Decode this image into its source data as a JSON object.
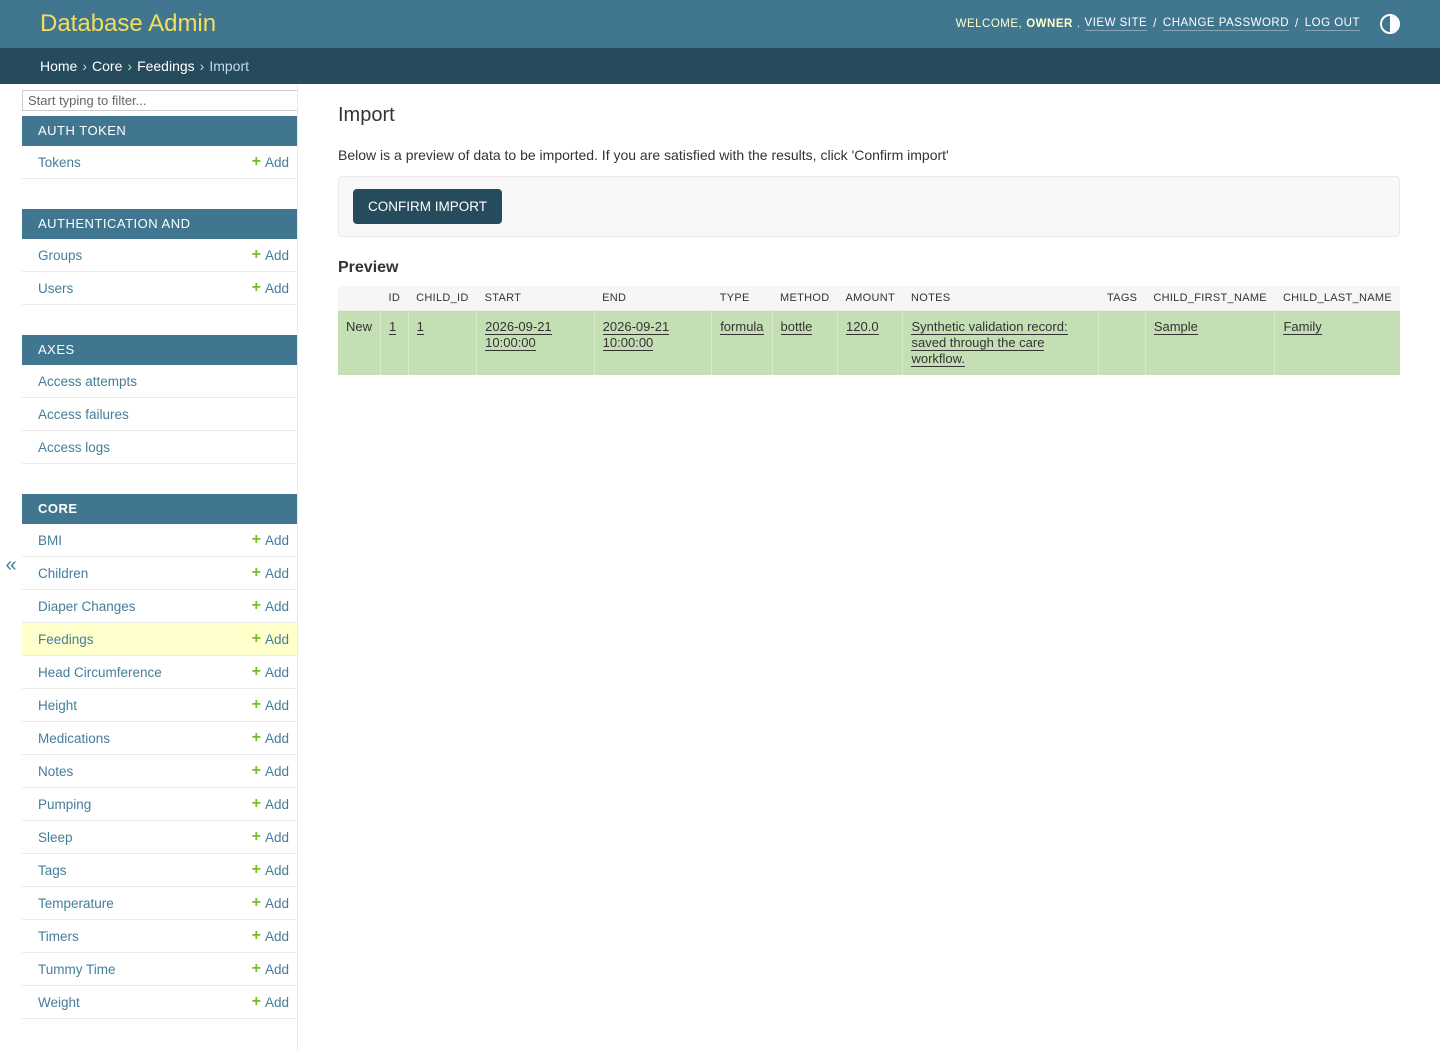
{
  "header": {
    "branding": "Database Admin",
    "welcome": "Welcome,",
    "username": "owner",
    "view_site": "View site",
    "change_password": "Change password",
    "log_out": "Log out"
  },
  "breadcrumbs": {
    "home": "Home",
    "app": "Core",
    "model": "Feedings",
    "current": "Import",
    "separator": "›"
  },
  "sidebar": {
    "filter_placeholder": "Start typing to filter...",
    "collapse_glyph": "«",
    "add_label": "Add",
    "modules": [
      {
        "caption": "Auth Token",
        "models": [
          {
            "name": "Tokens",
            "add": true
          }
        ]
      },
      {
        "caption": "Authentication and Authorization",
        "models": [
          {
            "name": "Groups",
            "add": true
          },
          {
            "name": "Users",
            "add": true
          }
        ]
      },
      {
        "caption": "Axes",
        "models": [
          {
            "name": "Access attempts",
            "add": false
          },
          {
            "name": "Access failures",
            "add": false
          },
          {
            "name": "Access logs",
            "add": false
          }
        ]
      },
      {
        "caption": "Core",
        "models": [
          {
            "name": "BMI",
            "add": true
          },
          {
            "name": "Children",
            "add": true
          },
          {
            "name": "Diaper Changes",
            "add": true
          },
          {
            "name": "Feedings",
            "add": true,
            "current": true
          },
          {
            "name": "Head Circumference",
            "add": true
          },
          {
            "name": "Height",
            "add": true
          },
          {
            "name": "Medications",
            "add": true
          },
          {
            "name": "Notes",
            "add": true
          },
          {
            "name": "Pumping",
            "add": true
          },
          {
            "name": "Sleep",
            "add": true
          },
          {
            "name": "Tags",
            "add": true
          },
          {
            "name": "Temperature",
            "add": true
          },
          {
            "name": "Timers",
            "add": true
          },
          {
            "name": "Tummy Time",
            "add": true
          },
          {
            "name": "Weight",
            "add": true
          }
        ]
      }
    ]
  },
  "content": {
    "title": "Import",
    "intro": "Below is a preview of data to be imported. If you are satisfied with the results, click 'Confirm import'",
    "confirm_button": "Confirm import",
    "preview_heading": "Preview",
    "table": {
      "headers": [
        "",
        "ID",
        "CHILD_ID",
        "START",
        "END",
        "TYPE",
        "METHOD",
        "AMOUNT",
        "NOTES",
        "TAGS",
        "CHILD_FIRST_NAME",
        "CHILD_LAST_NAME"
      ],
      "rows": [
        {
          "status": "New",
          "id": "1",
          "child_id": "1",
          "start": "2026-09-21 10:00:00",
          "end": "2026-09-21 10:00:00",
          "type": "formula",
          "method": "bottle",
          "amount": "120.0",
          "notes": "Synthetic validation record: saved through the care workflow.",
          "tags": "",
          "child_first_name": "Sample",
          "child_last_name": "Family"
        }
      ]
    }
  },
  "colors": {
    "header_bg": "#417690",
    "breadcrumb_bg": "#264b5d",
    "branding": "#f5dd5d",
    "link": "#447e9b",
    "add_icon": "#70bf2b",
    "current_row": "#ffffcc",
    "new_row": "#c5dfb5"
  }
}
